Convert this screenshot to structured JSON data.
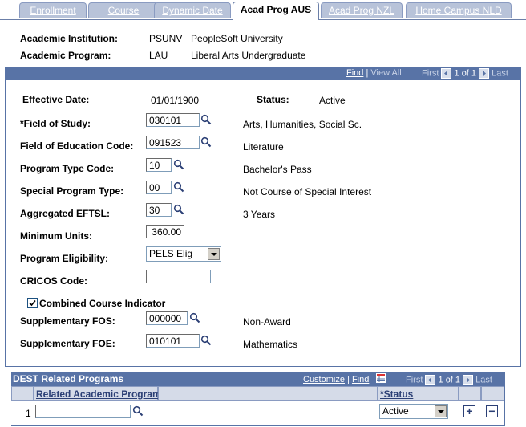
{
  "tabs": [
    {
      "label": "Enrollment"
    },
    {
      "label": "Course"
    },
    {
      "label": "Dynamic Date"
    },
    {
      "label": "Acad Prog AUS"
    },
    {
      "label": "Acad Prog NZL"
    },
    {
      "label": "Home Campus NLD"
    }
  ],
  "header": {
    "institution_label": "Academic Institution:",
    "institution_code": "PSUNV",
    "institution_name": "PeopleSoft University",
    "program_label": "Academic Program:",
    "program_code": "LAU",
    "program_name": "Liberal Arts Undergraduate"
  },
  "nav_bar": {
    "find": "Find",
    "view_all": "View All",
    "first": "First",
    "count": "1 of 1",
    "last": "Last"
  },
  "form": {
    "effective_date_label": "Effective Date:",
    "effective_date": "01/01/1900",
    "status_label": "Status:",
    "status": "Active",
    "field_of_study_label": "*Field of Study:",
    "field_of_study": "030101",
    "field_of_study_desc": "Arts, Humanities, Social Sc.",
    "field_of_education_label": "Field of Education Code:",
    "field_of_education": "091523",
    "field_of_education_desc": "Literature",
    "program_type_label": "Program Type Code:",
    "program_type": "10",
    "program_type_desc": "Bachelor's Pass",
    "special_program_label": "Special Program Type:",
    "special_program": "00",
    "special_program_desc": "Not Course of Special Interest",
    "eftsl_label": "Aggregated EFTSL:",
    "eftsl": "30",
    "eftsl_desc": "3 Years",
    "min_units_label": "Minimum Units:",
    "min_units": "360.00",
    "eligibility_label": "Program Eligibility:",
    "eligibility": "PELS Elig",
    "cricos_label": "CRICOS Code:",
    "cricos": "",
    "combined_label": "Combined Course Indicator",
    "supp_fos_label": "Supplementary FOS:",
    "supp_fos": "000000",
    "supp_fos_desc": "Non-Award",
    "supp_foe_label": "Supplementary FOE:",
    "supp_foe": "010101",
    "supp_foe_desc": "Mathematics"
  },
  "dest_grid": {
    "title": "DEST Related Programs",
    "customize": "Customize",
    "find": "Find",
    "first": "First",
    "count": "1 of 1",
    "last": "Last",
    "col_program": "Related Academic Program",
    "col_status": "*Status",
    "row_num": "1",
    "row_program": "",
    "row_status": "Active"
  }
}
